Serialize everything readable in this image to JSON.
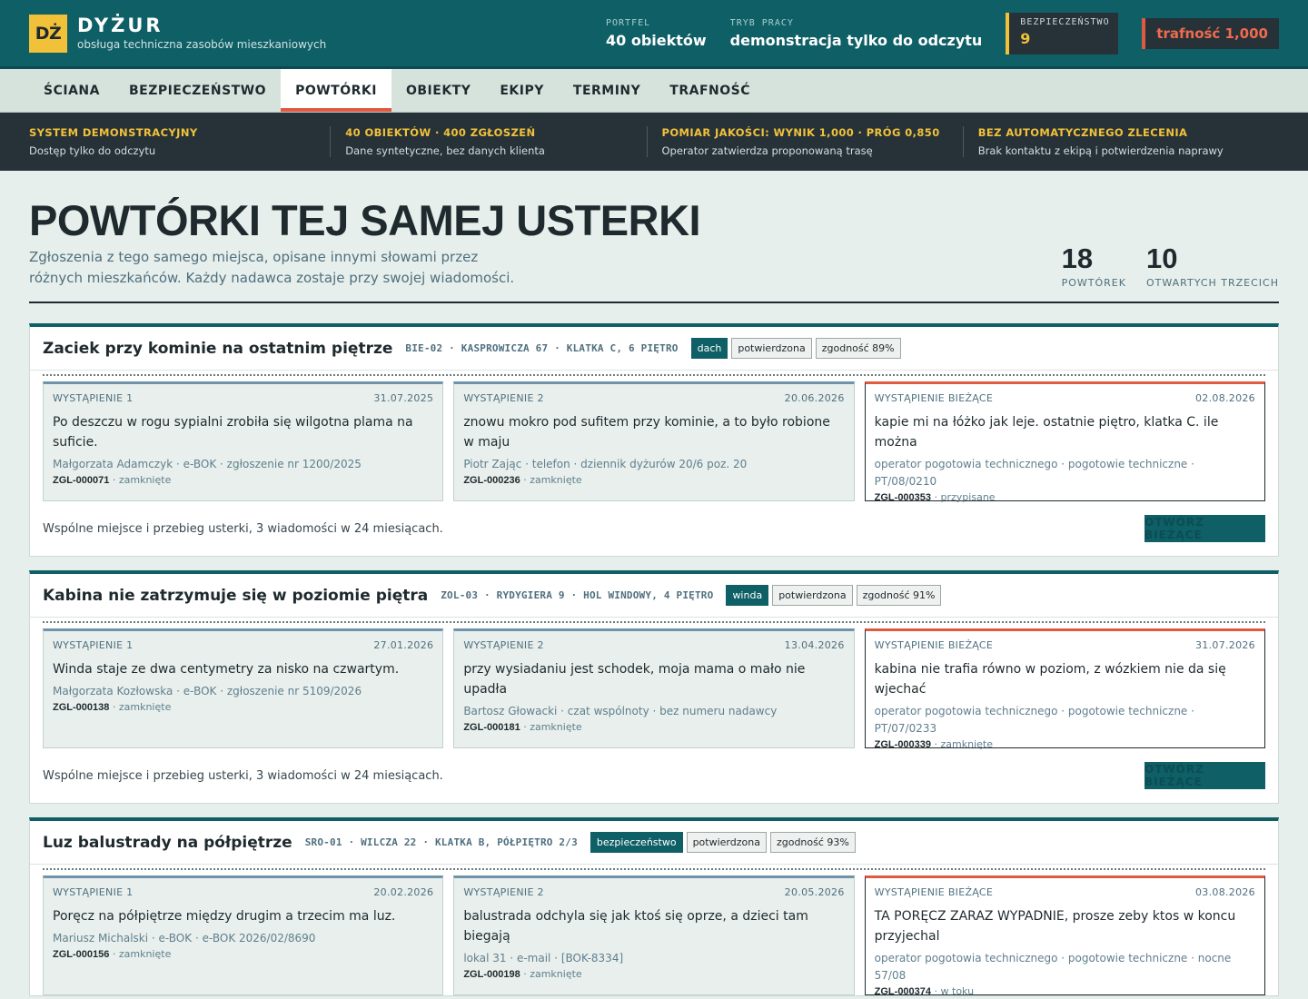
{
  "header": {
    "logo": "DŻ",
    "app_name": "DYŻUR",
    "app_subtitle": "obsługa techniczna zasobów mieszkaniowych",
    "portfolio_label": "PORTFEL",
    "portfolio_value": "40 obiektów",
    "mode_label": "TRYB PRACY",
    "mode_value": "demonstracja tylko do odczytu",
    "safety_label": "BEZPIECZEŃSTWO",
    "safety_value": "9",
    "accuracy": "trafność 1,000"
  },
  "nav": [
    "ŚCIANA",
    "BEZPIECZEŃSTWO",
    "POWTÓRKI",
    "OBIEKTY",
    "EKIPY",
    "TERMINY",
    "TRAFNOŚĆ"
  ],
  "band": [
    {
      "title": "SYSTEM DEMONSTRACYJNY",
      "sub": "Dostęp tylko do odczytu"
    },
    {
      "title": "40 OBIEKTÓW · 400 ZGŁOSZEŃ",
      "sub": "Dane syntetyczne, bez danych klienta"
    },
    {
      "title": "POMIAR JAKOŚCI: WYNIK 1,000 · PRÓG 0,850",
      "sub": "Operator zatwierdza proponowaną trasę"
    },
    {
      "title": "BEZ AUTOMATYCZNEGO ZLECENIA",
      "sub": "Brak kontaktu z ekipą i potwierdzenia naprawy"
    }
  ],
  "page": {
    "title": "POWTÓRKI TEJ SAMEJ USTERKI",
    "description": "Zgłoszenia z tego samego miejsca, opisane innymi słowami przez różnych mieszkańców. Każdy nadawca zostaje przy swojej wiadomości.",
    "stats": [
      {
        "num": "18",
        "label": "POWTÓREK"
      },
      {
        "num": "10",
        "label": "OTWARTYCH TRZECICH"
      }
    ]
  },
  "cases": [
    {
      "title": "Zaciek przy kominie na ostatnim piętrze",
      "location": "BIE-02 · KASPROWICZA 67 · KLATKA C, 6 PIĘTRO",
      "category": "dach",
      "status": "potwierdzona",
      "match": "zgodność 89%",
      "note": "Wspólne miejsce i przebieg usterki, 3 wiadomości w 24 miesiącach.",
      "button": "OTWÓRZ BIEŻĄCE",
      "occurrences": [
        {
          "label": "WYSTĄPIENIE 1",
          "date": "31.07.2025",
          "text": "Po deszczu w rogu sypialni zrobiła się wilgotna plama na suficie.",
          "source": "Małgorzata Adamczyk · e-BOK · zgłoszenie nr 1200/2025",
          "id": "ZGL-000071",
          "state": " · zamknięte"
        },
        {
          "label": "WYSTĄPIENIE 2",
          "date": "20.06.2026",
          "text": "znowu mokro pod sufitem przy kominie, a to było robione w maju",
          "source": "Piotr Zając · telefon · dziennik dyżurów 20/6 poz. 20",
          "id": "ZGL-000236",
          "state": " · zamknięte"
        },
        {
          "label": "WYSTĄPIENIE BIEŻĄCE",
          "date": "02.08.2026",
          "text": "kapie mi na łóżko jak leje. ostatnie piętro, klatka C. ile można",
          "source": "operator pogotowia technicznego · pogotowie techniczne · PT/08/0210",
          "id": "ZGL-000353",
          "state": " · przypisane"
        }
      ]
    },
    {
      "title": "Kabina nie zatrzymuje się w poziomie piętra",
      "location": "ZOL-03 · RYDYGIERA 9 · HOL WINDOWY, 4 PIĘTRO",
      "category": "winda",
      "status": "potwierdzona",
      "match": "zgodność 91%",
      "note": "Wspólne miejsce i przebieg usterki, 3 wiadomości w 24 miesiącach.",
      "button": "OTWÓRZ BIEŻĄCE",
      "occurrences": [
        {
          "label": "WYSTĄPIENIE 1",
          "date": "27.01.2026",
          "text": "Winda staje ze dwa centymetry za nisko na czwartym.",
          "source": "Małgorzata Kozłowska · e-BOK · zgłoszenie nr 5109/2026",
          "id": "ZGL-000138",
          "state": " · zamknięte"
        },
        {
          "label": "WYSTĄPIENIE 2",
          "date": "13.04.2026",
          "text": "przy wysiadaniu jest schodek, moja mama o mało nie upadła",
          "source": "Bartosz Głowacki · czat wspólnoty · bez numeru nadawcy",
          "id": "ZGL-000181",
          "state": " · zamknięte"
        },
        {
          "label": "WYSTĄPIENIE BIEŻĄCE",
          "date": "31.07.2026",
          "text": "kabina nie trafia równo w poziom, z wózkiem nie da się wjechać",
          "source": "operator pogotowia technicznego · pogotowie techniczne · PT/07/0233",
          "id": "ZGL-000339",
          "state": " · zamknięte"
        }
      ]
    },
    {
      "title": "Luz balustrady na półpiętrze",
      "location": "SRO-01 · WILCZA 22 · KLATKA B, PÓŁPIĘTRO 2/3",
      "category": "bezpieczeństwo",
      "status": "potwierdzona",
      "match": "zgodność 93%",
      "note": "",
      "button": "",
      "occurrences": [
        {
          "label": "WYSTĄPIENIE 1",
          "date": "20.02.2026",
          "text": "Poręcz na półpiętrze między drugim a trzecim ma luz.",
          "source": "Mariusz Michalski · e-BOK · e-BOK 2026/02/8690",
          "id": "ZGL-000156",
          "state": " · zamknięte"
        },
        {
          "label": "WYSTĄPIENIE 2",
          "date": "20.05.2026",
          "text": "balustrada odchyla się jak ktoś się oprze, a dzieci tam biegają",
          "source": "lokal 31 · e-mail · [BOK-8334]",
          "id": "ZGL-000198",
          "state": " · zamknięte"
        },
        {
          "label": "WYSTĄPIENIE BIEŻĄCE",
          "date": "03.08.2026",
          "text": "TA PORĘCZ ZARAZ WYPADNIE, prosze zeby ktos w koncu przyjechal",
          "source": "operator pogotowia technicznego · pogotowie techniczne · nocne 57/08",
          "id": "ZGL-000374",
          "state": " · w toku"
        }
      ]
    }
  ]
}
